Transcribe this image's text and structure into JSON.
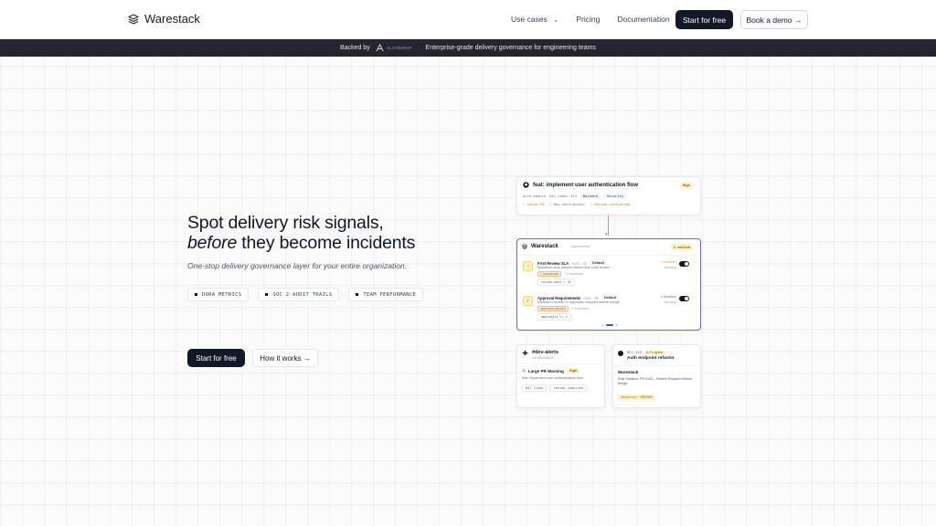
{
  "nav": {
    "logo": "Warestack",
    "links": [
      "Use cases",
      "Pricing",
      "Documentation"
    ],
    "start_free": "Start for free",
    "book_demo": "Book a demo →"
  },
  "banner": {
    "backed_by": "Backed by",
    "backer_name": "ALCHEMIST",
    "separator": "·",
    "tagline": "Enterprise-grade delivery governance for engineering teams"
  },
  "hero": {
    "title_line1": "Spot delivery risk signals,",
    "title_em": "before",
    "title_line2_rest": " they become incidents",
    "subtitle": "One-stop delivery governance layer for your entire organization.",
    "tags": [
      "DORA METRICS",
      "SOC 2 AUDIT TRAILS",
      "TEAM PERFORMANCE"
    ],
    "cta_primary": "Start for free",
    "cta_secondary": "How it works →"
  },
  "pr_card": {
    "title": "feat: implement user authentication flow",
    "priority": "High",
    "branch": "auth-module",
    "reviewer": "dev-cedar-123",
    "labels": [
      "Backend",
      "Security"
    ],
    "size": "Large PR",
    "contributor": "New contributor",
    "review_status": "Review unresolved"
  },
  "warestack_card": {
    "title": "Warestack",
    "subtitle": "Agreements",
    "edited": "2 edited",
    "rules": [
      {
        "name": "First Review SLA",
        "version": "Auto · 4s",
        "tag": "Default",
        "description": "Maximum time allowed before first code review",
        "chip": "2 repositories",
        "extra": "+ 4 workflows",
        "param": "review_wait > 4h",
        "violations": "3 violations",
        "mode": "Blocking"
      },
      {
        "name": "Approval Requirements",
        "version": "Auto · 8s",
        "tag": "Default",
        "description": "Minimum number of approvals required before merge",
        "chip": "approved-required",
        "extra": "+ 6 decisions",
        "param": "approvals >= 2",
        "violations": "0 violations",
        "mode": "Blocking"
      }
    ]
  },
  "slack_card": {
    "channel": "#dev-alerts",
    "via": "via Warestack",
    "warning": "Large PR Warning",
    "priority": "High",
    "text": "feat: implement user authentication flow",
    "chips": [
      "847 lines",
      "review required"
    ]
  },
  "linear_card": {
    "id": "DEV-589",
    "status": "In Progress",
    "title": "Auth endpoint refactor",
    "ws_label": "Warestack",
    "rule": "Rule Violation: PR #143 – Review Required Before Merge",
    "severity": "Severity: MEDIUM"
  }
}
